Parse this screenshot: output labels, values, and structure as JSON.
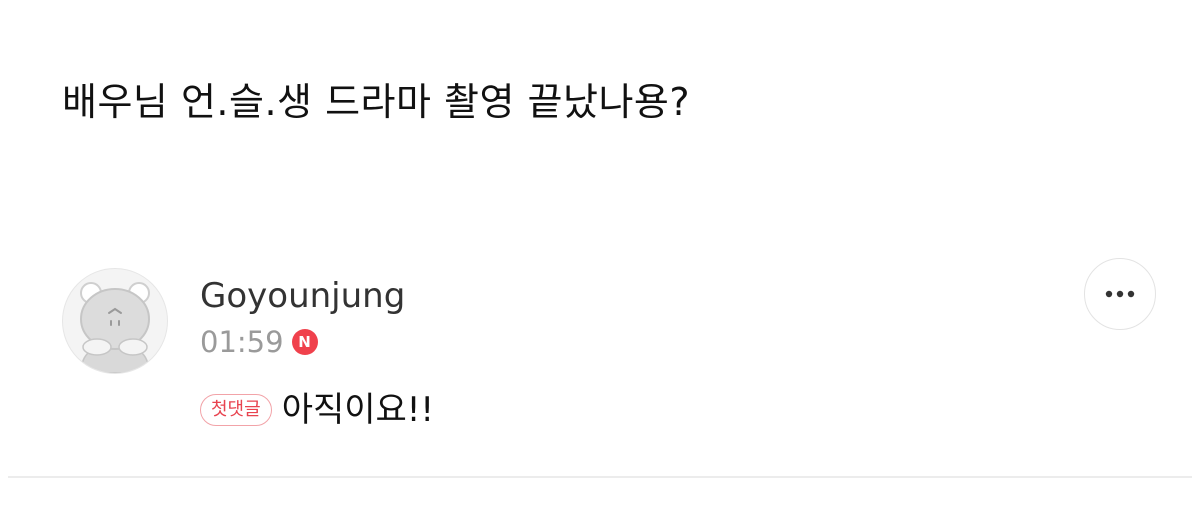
{
  "post": {
    "text": "배우님 언.슬.생 드라마 촬영 끝났나용?"
  },
  "comment": {
    "author": "Goyounjung",
    "time": "01:59",
    "new_badge": "N",
    "first_comment_badge": "첫댓글",
    "text": "아직이요!!",
    "avatar_icon": "default-character-avatar-icon",
    "more_icon": "more-horizontal-icon"
  },
  "colors": {
    "accent_red": "#f0414c",
    "text_primary": "#111111",
    "text_secondary": "#9a9a9a"
  }
}
